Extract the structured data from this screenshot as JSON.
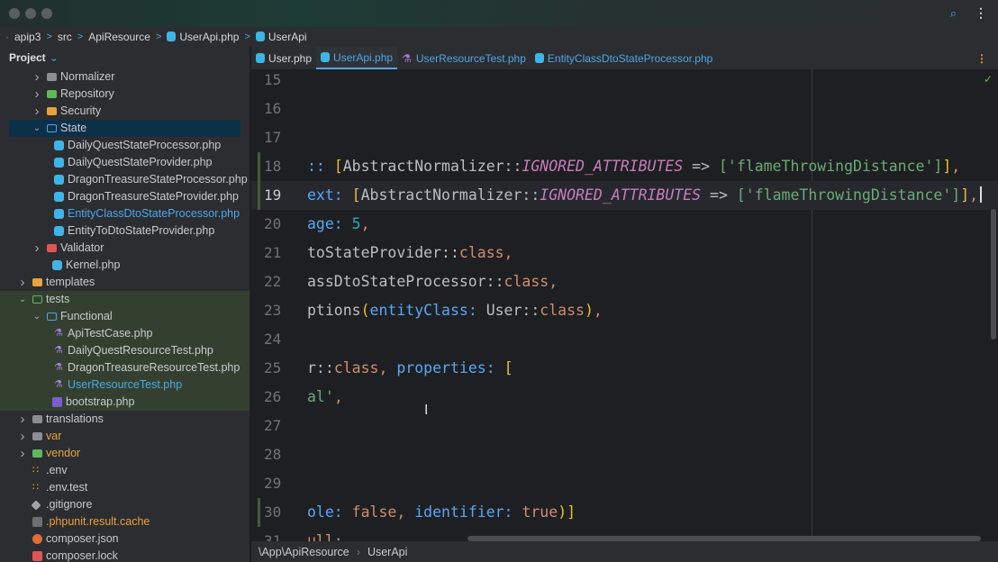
{
  "window": {
    "icons": {
      "search": "search-icon",
      "more": "more-vert-icon"
    }
  },
  "breadcrumb": [
    "apip3",
    "src",
    "ApiResource",
    "UserApi.php",
    "UserApi"
  ],
  "sidebar": {
    "title": "Project",
    "items": [
      {
        "label": "Normalizer",
        "indent": 2,
        "kind": "folder",
        "chev": ">"
      },
      {
        "label": "Repository",
        "indent": 2,
        "kind": "fgreen",
        "chev": ">"
      },
      {
        "label": "Security",
        "indent": 2,
        "kind": "fyellow",
        "chev": ">"
      },
      {
        "label": "State",
        "indent": 2,
        "kind": "fblue",
        "chev": "v",
        "selected": true
      },
      {
        "label": "DailyQuestStateProcessor.php",
        "indent": 3,
        "kind": "php"
      },
      {
        "label": "DailyQuestStateProvider.php",
        "indent": 3,
        "kind": "php"
      },
      {
        "label": "DragonTreasureStateProcessor.php",
        "indent": 3,
        "kind": "php"
      },
      {
        "label": "DragonTreasureStateProvider.php",
        "indent": 3,
        "kind": "php"
      },
      {
        "label": "EntityClassDtoStateProcessor.php",
        "indent": 3,
        "kind": "php",
        "color": "#4ea6e8"
      },
      {
        "label": "EntityToDtoStateProvider.php",
        "indent": 3,
        "kind": "php"
      },
      {
        "label": "Validator",
        "indent": 2,
        "kind": "fred",
        "chev": ">"
      },
      {
        "label": "Kernel.php",
        "indent": 2,
        "kind": "php"
      },
      {
        "label": "templates",
        "indent": 1,
        "kind": "fyellow",
        "chev": ">"
      },
      {
        "label": "tests",
        "indent": 1,
        "kind": "fgreenol",
        "chev": "v",
        "green": true
      },
      {
        "label": "Functional",
        "indent": 2,
        "kind": "fblue",
        "chev": "v",
        "green": true
      },
      {
        "label": "ApiTestCase.php",
        "indent": 3,
        "kind": "test",
        "green": true
      },
      {
        "label": "DailyQuestResourceTest.php",
        "indent": 3,
        "kind": "test",
        "green": true
      },
      {
        "label": "DragonTreasureResourceTest.php",
        "indent": 3,
        "kind": "test",
        "green": true
      },
      {
        "label": "UserResourceTest.php",
        "indent": 3,
        "kind": "test",
        "green": true,
        "color": "#4ea6e8"
      },
      {
        "label": "bootstrap.php",
        "indent": 2,
        "kind": "boot",
        "green": true
      },
      {
        "label": "translations",
        "indent": 1,
        "kind": "folder",
        "chev": ">"
      },
      {
        "label": "var",
        "indent": 1,
        "kind": "folder",
        "chev": ">",
        "color": "#e8a33a"
      },
      {
        "label": "vendor",
        "indent": 1,
        "kind": "fgreen",
        "chev": ">",
        "color": "#e8a33a"
      },
      {
        "label": ".env",
        "indent": 1,
        "kind": "cfg"
      },
      {
        "label": ".env.test",
        "indent": 1,
        "kind": "cfg"
      },
      {
        "label": ".gitignore",
        "indent": 1,
        "kind": "git"
      },
      {
        "label": ".phpunit.result.cache",
        "indent": 1,
        "kind": "cache",
        "color": "#e8a33a"
      },
      {
        "label": "composer.json",
        "indent": 1,
        "kind": "comp"
      },
      {
        "label": "composer.lock",
        "indent": 1,
        "kind": "lock"
      }
    ]
  },
  "tabs": [
    {
      "label": "User.php",
      "type": "php"
    },
    {
      "label": "UserApi.php",
      "type": "php",
      "active": true
    },
    {
      "label": "UserResourceTest.php",
      "type": "test"
    },
    {
      "label": "EntityClassDtoStateProcessor.php",
      "type": "link"
    }
  ],
  "editor": {
    "current_line": 19,
    "lines": [
      {
        "n": 15,
        "t": []
      },
      {
        "n": 16,
        "t": []
      },
      {
        "n": 17,
        "t": []
      },
      {
        "n": 18,
        "t": [
          [
            "p",
            ":: "
          ],
          [
            "b",
            "["
          ],
          [
            "d",
            "AbstractNormalizer::"
          ],
          [
            "c",
            "IGNORED_ATTRIBUTES"
          ],
          [
            "d",
            " => "
          ],
          [
            "s",
            "['flameThrowingDistance']"
          ],
          [
            "b",
            "]"
          ],
          [
            "k",
            ","
          ]
        ]
      },
      {
        "n": 19,
        "t": [
          [
            "p",
            "ext: "
          ],
          [
            "b",
            "["
          ],
          [
            "d",
            "AbstractNormalizer::"
          ],
          [
            "c",
            "IGNORED_ATTRIBUTES"
          ],
          [
            "d",
            " => "
          ],
          [
            "s",
            "['flameThrowingDistance']"
          ],
          [
            "b",
            "]"
          ],
          [
            "k",
            ","
          ]
        ]
      },
      {
        "n": 20,
        "t": [
          [
            "p",
            "age: "
          ],
          [
            "n",
            "5"
          ],
          [
            "k",
            ","
          ]
        ]
      },
      {
        "n": 21,
        "t": [
          [
            "d",
            "toStateProvider::"
          ],
          [
            "k",
            "class,"
          ]
        ]
      },
      {
        "n": 22,
        "t": [
          [
            "d",
            "assDtoStateProcessor::"
          ],
          [
            "k",
            "class,"
          ]
        ]
      },
      {
        "n": 23,
        "t": [
          [
            "d",
            "ptions"
          ],
          [
            "b",
            "("
          ],
          [
            "p",
            "entityClass: "
          ],
          [
            "d",
            "User::"
          ],
          [
            "k",
            "class"
          ],
          [
            "b",
            ")"
          ],
          [
            "k",
            ","
          ]
        ]
      },
      {
        "n": 24,
        "t": []
      },
      {
        "n": 25,
        "t": [
          [
            "d",
            "r::"
          ],
          [
            "k",
            "class, "
          ],
          [
            "p",
            "properties: "
          ],
          [
            "b",
            "["
          ]
        ]
      },
      {
        "n": 26,
        "t": [
          [
            "s",
            "al'"
          ],
          [
            "k",
            ","
          ]
        ]
      },
      {
        "n": 27,
        "t": []
      },
      {
        "n": 28,
        "t": []
      },
      {
        "n": 29,
        "t": []
      },
      {
        "n": 30,
        "t": [
          [
            "p",
            "ole: "
          ],
          [
            "k",
            "false, "
          ],
          [
            "p",
            "identifier: "
          ],
          [
            "k",
            "true"
          ],
          [
            "b",
            ")]"
          ]
        ]
      },
      {
        "n": 31,
        "t": [
          [
            "k",
            "ull;"
          ]
        ]
      }
    ]
  },
  "status": {
    "path": "\\App\\ApiResource",
    "symbol": "UserApi"
  }
}
